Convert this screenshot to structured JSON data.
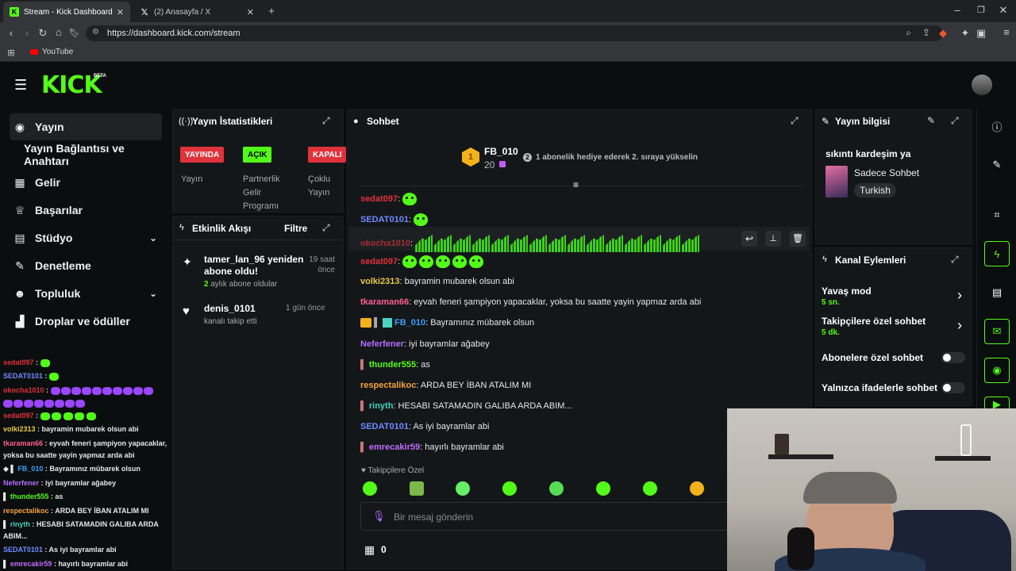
{
  "browser": {
    "tabs": [
      {
        "title": "Stream - Kick Dashboard",
        "icon": "kick-icon"
      },
      {
        "title": "(2) Anasayfa / X",
        "icon": "x-icon"
      }
    ],
    "url": "https://dashboard.kick.com/stream",
    "bookmark": "YouTube"
  },
  "header": {
    "logo": "KICK",
    "beta": "BETA"
  },
  "sidebar": {
    "items": [
      {
        "label": "Yayın",
        "icon": "broadcast-icon"
      },
      {
        "label": "Yayın Bağlantısı ve Anahtarı",
        "icon": ""
      },
      {
        "label": "Gelir",
        "icon": "chart-icon"
      },
      {
        "label": "Başarılar",
        "icon": "trophy-icon"
      },
      {
        "label": "Stüdyo",
        "icon": "studio-icon"
      },
      {
        "label": "Denetleme",
        "icon": "wrench-icon"
      },
      {
        "label": "Topluluk",
        "icon": "community-icon"
      },
      {
        "label": "Droplar ve ödüller",
        "icon": "gift-icon"
      }
    ]
  },
  "stats": {
    "title": "Yayın İstatistikleri",
    "badges": [
      "YAYINDA",
      "AÇIK",
      "KAPALI"
    ],
    "labels": [
      "Yayın",
      "Partnerlik Gelir Programı",
      "Çoklu Yayın"
    ]
  },
  "activity": {
    "title": "Etkinlik Akışı",
    "filter": "Filtre",
    "items": [
      {
        "title": "tamer_lan_96 yeniden abone oldu!",
        "sub_highlight": "2",
        "sub": "aylık abone oldular",
        "time": "19 saat önce"
      },
      {
        "title": "denis_0101",
        "sub_highlight": "",
        "sub": "kanalı takip etti",
        "time": "1 gün önce"
      }
    ]
  },
  "chat": {
    "title": "Sohbet",
    "top_gifter": {
      "rank": "1",
      "name": "FB_010",
      "count": "20"
    },
    "gift_hint": "1 abonelik hediye ederek 2. sıraya yükselin",
    "messages": [
      {
        "user": "sedat097",
        "text": "",
        "color": "#e0323c"
      },
      {
        "user": "SEDAT0101",
        "text": "",
        "color": "#6f8bff"
      },
      {
        "user": "okocha1010",
        "text": "",
        "color": "#e0323c"
      },
      {
        "user": "sedat097",
        "text": "",
        "color": "#e0323c"
      },
      {
        "user": "volki2313",
        "text": "bayramin mubarek olsun abi",
        "color": "#e8c84a"
      },
      {
        "user": "tkaraman66",
        "text": "eyvah feneri şampiyon yapacaklar, yoksa bu saatte yayin yapmaz arda abi",
        "color": "#ff5f8f"
      },
      {
        "user": "FB_010",
        "text": "Bayramınız mübarek olsun",
        "color": "#3aa0ff"
      },
      {
        "user": "Neferfener",
        "text": "iyi bayramlar ağabey",
        "color": "#b36cff"
      },
      {
        "user": "thunder555",
        "text": "as",
        "color": "#53fc18"
      },
      {
        "user": "respectalikoc",
        "text": "ARDA BEY İBAN ATALIM MI",
        "color": "#f4a340"
      },
      {
        "user": "rinyth",
        "text": "HESABI SATAMADIN GALIBA ARDA ABIM...",
        "color": "#40d3c0"
      },
      {
        "user": "SEDAT0101",
        "text": "As iyi bayramlar abi",
        "color": "#6f8bff"
      },
      {
        "user": "emrecakir59",
        "text": "hayırlı bayramlar abi",
        "color": "#c06cff"
      }
    ],
    "followers_only": "Takipçilere Özel",
    "input_placeholder": "Bir mesaj gönderin",
    "viewer_count": "0"
  },
  "stream_info": {
    "title": "Yayın bilgisi",
    "stream_title": "sıkıntı kardeşim ya",
    "category": "Sadece Sohbet",
    "language": "Turkish"
  },
  "channel_actions": {
    "title": "Kanal Eylemleri",
    "items": [
      {
        "label": "Yavaş mod",
        "value": "5 sn."
      },
      {
        "label": "Takipçilere özel sohbet",
        "value": "5 dk."
      },
      {
        "label": "Abonelere özel sohbet",
        "value": ""
      },
      {
        "label": "Yalnızca ifadelerle sohbet",
        "value": ""
      }
    ]
  },
  "side_chat": [
    {
      "user": "sedat097",
      "text": ""
    },
    {
      "user": "SEDAT0101",
      "text": ""
    },
    {
      "user": "okocha1010",
      "text": ""
    },
    {
      "user": "sedat097",
      "text": ""
    },
    {
      "user": "volki2313",
      "text": "bayramin mubarek olsun abi"
    },
    {
      "user": "tkaraman66",
      "text": "eyvah feneri şampiyon yapacaklar,"
    },
    {
      "user": "",
      "text": "yoksa bu saatte yayin yapmaz arda abi"
    },
    {
      "user": "FB_010",
      "text": "Bayramınız mübarek olsun"
    },
    {
      "user": "Neferfener",
      "text": "iyi bayramlar ağabey"
    },
    {
      "user": "thunder555",
      "text": "as"
    },
    {
      "user": "respectalikoc",
      "text": "ARDA BEY İBAN ATALIM MI"
    },
    {
      "user": "rinyth",
      "text": "HESABI SATAMADIN GALIBA ARDA"
    },
    {
      "user": "",
      "text": "ABIM..."
    },
    {
      "user": "SEDAT0101",
      "text": "As iyi bayramlar abi"
    },
    {
      "user": "emrecakir59",
      "text": "hayırlı bayramlar abi"
    }
  ],
  "colors": {
    "accent": "#53fc18",
    "live": "#e0323c",
    "bg": "#0b0e0f",
    "panel": "#141719"
  }
}
